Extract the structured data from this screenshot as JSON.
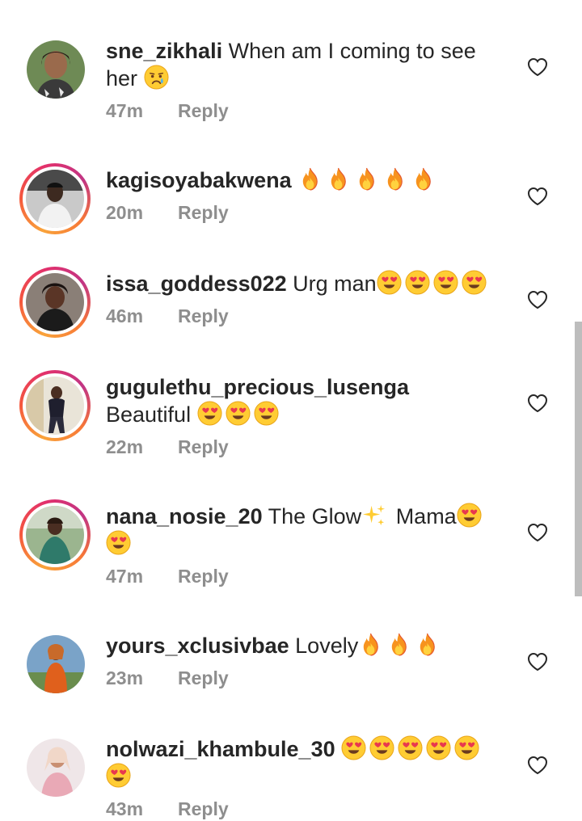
{
  "comments": [
    {
      "username": "sne_zikhali",
      "text": "When am I coming to see her",
      "emojis": [
        "crying-face"
      ],
      "time": "47m",
      "reply": "Reply",
      "story_ring": false
    },
    {
      "username": "kagisoyabakwena",
      "text": "",
      "emojis": [
        "fire",
        "fire",
        "fire",
        "fire",
        "fire"
      ],
      "time": "20m",
      "reply": "Reply",
      "story_ring": true
    },
    {
      "username": "issa_goddess022",
      "text": "Urg man",
      "emojis": [
        "heart-eyes",
        "heart-eyes",
        "heart-eyes",
        "heart-eyes"
      ],
      "time": "46m",
      "reply": "Reply",
      "story_ring": true
    },
    {
      "username": "gugulethu_precious_lusenga",
      "text": "Beautiful",
      "emojis": [
        "heart-eyes",
        "heart-eyes",
        "heart-eyes"
      ],
      "time": "22m",
      "reply": "Reply",
      "story_ring": true
    },
    {
      "username": "nana_nosie_20",
      "text": "The Glow",
      "text2": "Mama",
      "emojis": [
        "sparkles",
        "heart-eyes",
        "heart-eyes"
      ],
      "time": "47m",
      "reply": "Reply",
      "story_ring": true
    },
    {
      "username": "yours_xclusivbae",
      "text": "Lovely",
      "emojis": [
        "fire",
        "fire",
        "fire"
      ],
      "time": "23m",
      "reply": "Reply",
      "story_ring": false
    },
    {
      "username": "nolwazi_khambule_30",
      "text": "",
      "emojis": [
        "heart-eyes",
        "heart-eyes",
        "heart-eyes",
        "heart-eyes",
        "heart-eyes",
        "heart-eyes"
      ],
      "time": "43m",
      "reply": "Reply",
      "story_ring": false
    }
  ],
  "colors": {
    "text": "#262626",
    "meta": "#8e8e8e",
    "story_ring_start": "#f9a33a",
    "story_ring_end": "#c13584"
  }
}
